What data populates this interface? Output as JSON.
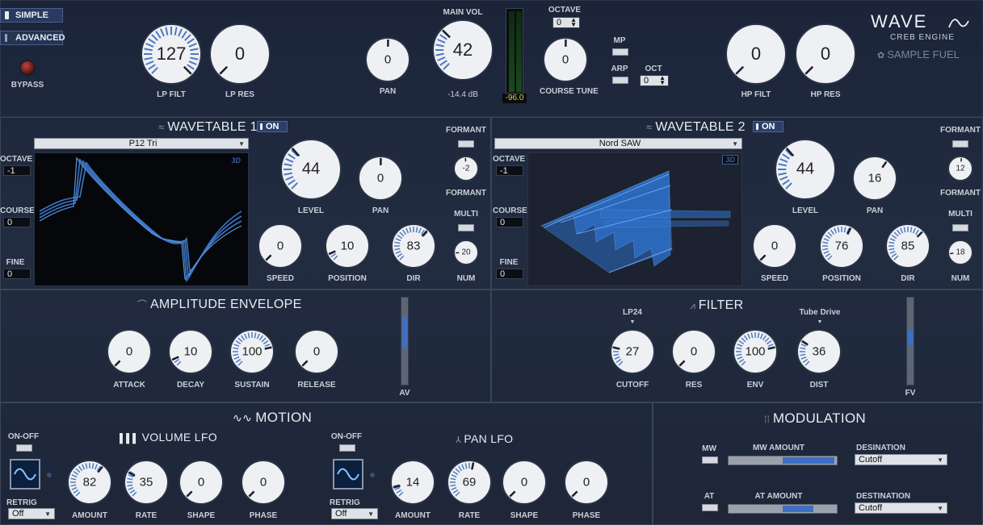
{
  "mode": {
    "simple": "SIMPLE",
    "advanced": "ADVANCED",
    "bypass": "BYPASS"
  },
  "top": {
    "lp_filt": {
      "label": "LP FILT",
      "value": "127"
    },
    "lp_res": {
      "label": "LP RES",
      "value": "0"
    },
    "pan": {
      "label": "PAN",
      "value": "0"
    },
    "main_vol": {
      "title": "MAIN VOL",
      "value": "42",
      "db": "-14.4 dB"
    },
    "meter_readout": "-96.0",
    "octave": {
      "label": "OCTAVE",
      "value": "0"
    },
    "course_tune": {
      "label": "COURSE TUNE",
      "value": "0"
    },
    "mp": "MP",
    "arp": "ARP",
    "oct": {
      "label": "OCT",
      "value": "0"
    },
    "hp_filt": {
      "label": "HP FILT",
      "value": "0"
    },
    "hp_res": {
      "label": "HP RES",
      "value": "0"
    }
  },
  "logo": {
    "wave": "WAVE",
    "engine": "CREB ENGINE",
    "brand": "SAMPLE FUEL"
  },
  "wt1": {
    "title": "WAVETABLE 1",
    "on": "ON",
    "preset": "P12 Tri",
    "tag": "3D",
    "octave_label": "OCTAVE",
    "octave": "-1",
    "course_label": "COURSE",
    "course": "0",
    "fine_label": "FINE",
    "fine": "0",
    "level": {
      "label": "LEVEL",
      "value": "44"
    },
    "pan": {
      "label": "PAN",
      "value": "0"
    },
    "speed": {
      "label": "SPEED",
      "value": "0"
    },
    "position": {
      "label": "POSITION",
      "value": "10"
    },
    "dir": {
      "label": "DIR",
      "value": "83"
    },
    "formant_top": "FORMANT",
    "formant": {
      "label": "FORMANT",
      "value": "-2"
    },
    "multi": "MULTI",
    "num": {
      "label": "NUM",
      "value": "20"
    }
  },
  "wt2": {
    "title": "WAVETABLE 2",
    "on": "ON",
    "preset": "Nord SAW",
    "tag": "3D",
    "octave_label": "OCTAVE",
    "octave": "-1",
    "course_label": "COURSE",
    "course": "0",
    "fine_label": "FINE",
    "fine": "0",
    "level": {
      "label": "LEVEL",
      "value": "44"
    },
    "pan": {
      "label": "PAN",
      "value": "16"
    },
    "speed": {
      "label": "SPEED",
      "value": "0"
    },
    "position": {
      "label": "POSITION",
      "value": "76"
    },
    "dir": {
      "label": "DIR",
      "value": "85"
    },
    "formant_top": "FORMANT",
    "formant": {
      "label": "FORMANT",
      "value": "12"
    },
    "multi": "MULTI",
    "num": {
      "label": "NUM",
      "value": "18"
    }
  },
  "amp_env": {
    "title": "AMPLITUDE ENVELOPE",
    "attack": {
      "label": "ATTACK",
      "value": "0"
    },
    "decay": {
      "label": "DECAY",
      "value": "10"
    },
    "sustain": {
      "label": "SUSTAIN",
      "value": "100"
    },
    "release": {
      "label": "RELEASE",
      "value": "0"
    },
    "av": "AV",
    "av_level": 0.6
  },
  "filter": {
    "title": "FILTER",
    "type": "LP24",
    "drive": "Tube Drive",
    "cutoff": {
      "label": "CUTOFF",
      "value": "27"
    },
    "res": {
      "label": "RES",
      "value": "0"
    },
    "env": {
      "label": "ENV",
      "value": "100"
    },
    "dist": {
      "label": "DIST",
      "value": "36"
    },
    "fv": "FV",
    "fv_level": 0.3
  },
  "motion": {
    "title": "MOTION",
    "vol_lfo": {
      "title": "VOLUME LFO",
      "on_off": "ON-OFF",
      "retrig": "RETRIG",
      "retrig_value": "Off",
      "amount": {
        "label": "AMOUNT",
        "value": "82"
      },
      "rate": {
        "label": "RATE",
        "value": "35"
      },
      "shape": {
        "label": "SHAPE",
        "value": "0"
      },
      "phase": {
        "label": "PHASE",
        "value": "0"
      }
    },
    "pan_lfo": {
      "title": "PAN LFO",
      "on_off": "ON-OFF",
      "retrig": "RETRIG",
      "retrig_value": "Off",
      "amount": {
        "label": "AMOUNT",
        "value": "14"
      },
      "rate": {
        "label": "RATE",
        "value": "69"
      },
      "shape": {
        "label": "SHAPE",
        "value": "0"
      },
      "phase": {
        "label": "PHASE",
        "value": "0"
      }
    }
  },
  "modulation": {
    "title": "MODULATION",
    "mw": "MW",
    "mw_amount": "MW AMOUNT",
    "mw_dest_label": "DESINATION",
    "mw_dest": "Cutoff",
    "at": "AT",
    "at_amount": "AT AMOUNT",
    "at_dest_label": "DESTINATION",
    "at_dest": "Cutoff",
    "mw_range": [
      0.5,
      0.98
    ],
    "at_range": [
      0.5,
      0.78
    ]
  }
}
